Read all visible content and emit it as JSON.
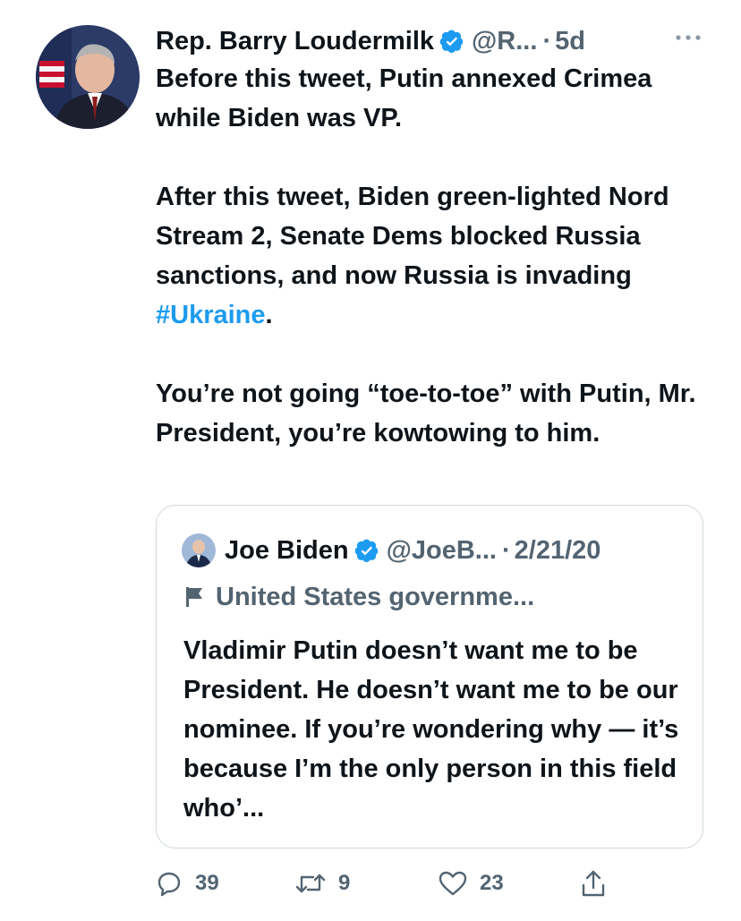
{
  "tweet": {
    "author_name": "Rep. Barry Loudermilk",
    "handle": "@R...",
    "separator": "·",
    "time": "5d",
    "paragraphs": [
      "Before this tweet, Putin annexed Crimea while Biden was VP.",
      "After this tweet, Biden green-lighted Nord Stream 2, Senate Dems blocked Russia sanctions, and now Russia is",
      "You’re not going “toe-to-toe” with Putin, Mr. President, you’re kowtowing to him."
    ],
    "paragraph2_tail_before": "invading ",
    "hashtag": "#Ukraine",
    "paragraph2_tail_after": "."
  },
  "quote": {
    "author_name": "Joe Biden",
    "handle": "@JoeB...",
    "separator": "·",
    "date": "2/21/20",
    "label": "United States governme...",
    "text": "Vladimir Putin doesn’t want me to be President. He doesn’t want me to be our nominee. If you’re wondering why — it’s because I’m the only person in this field who’..."
  },
  "actions": {
    "reply_count": "39",
    "retweet_count": "9",
    "like_count": "23"
  },
  "colors": {
    "text_primary": "#0f1419",
    "text_secondary": "#536471",
    "accent": "#1d9bf0",
    "border": "#cfd9de"
  },
  "icons": {
    "verified": "verified-badge-icon",
    "more": "more-horizontal-icon",
    "flag": "flag-icon",
    "reply": "reply-icon",
    "retweet": "retweet-icon",
    "like": "heart-icon",
    "share": "share-icon"
  }
}
